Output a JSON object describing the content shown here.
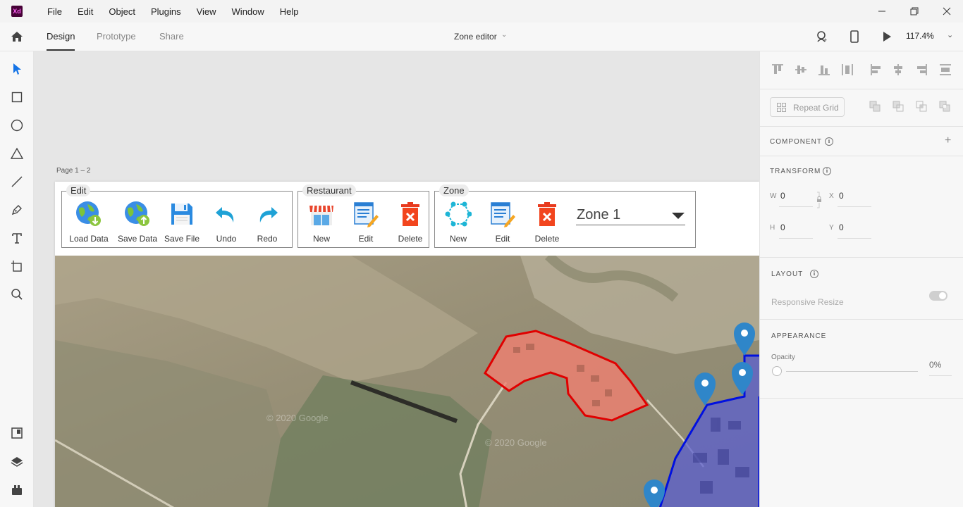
{
  "menubar": {
    "logo": "Xd",
    "items": [
      "File",
      "Edit",
      "Object",
      "Plugins",
      "View",
      "Window",
      "Help"
    ]
  },
  "appbar": {
    "tabs": [
      "Design",
      "Prototype",
      "Share"
    ],
    "document_title": "Zone editor",
    "zoom": "117.4%"
  },
  "canvas": {
    "artboard_label": "Page 1 – 2"
  },
  "ribbon": {
    "edit": {
      "title": "Edit",
      "buttons": [
        "Load Data",
        "Save Data",
        "Save File",
        "Undo",
        "Redo"
      ]
    },
    "restaurant": {
      "title": "Restaurant",
      "buttons": [
        "New",
        "Edit",
        "Delete"
      ]
    },
    "zone": {
      "title": "Zone",
      "buttons": [
        "New",
        "Edit",
        "Delete"
      ],
      "selected_zone": "Zone 1"
    }
  },
  "map": {
    "watermark_1": "© 2020 Google",
    "watermark_2": "© 2020 Google",
    "red_zone_color": "#e00000",
    "blue_zone_color": "#0010e0",
    "marker_color": "#2f86c9"
  },
  "panel": {
    "repeat_grid": "Repeat Grid",
    "component": "COMPONENT",
    "transform": "TRANSFORM",
    "w_label": "W",
    "w_value": "0",
    "x_label": "X",
    "x_value": "0",
    "h_label": "H",
    "h_value": "0",
    "y_label": "Y",
    "y_value": "0",
    "layout": "LAYOUT",
    "responsive_resize": "Responsive Resize",
    "appearance": "APPEARANCE",
    "opacity_label": "Opacity",
    "opacity_value": "0%"
  },
  "colors": {
    "accent": "#1473e6",
    "xd_brand": "#470137"
  }
}
